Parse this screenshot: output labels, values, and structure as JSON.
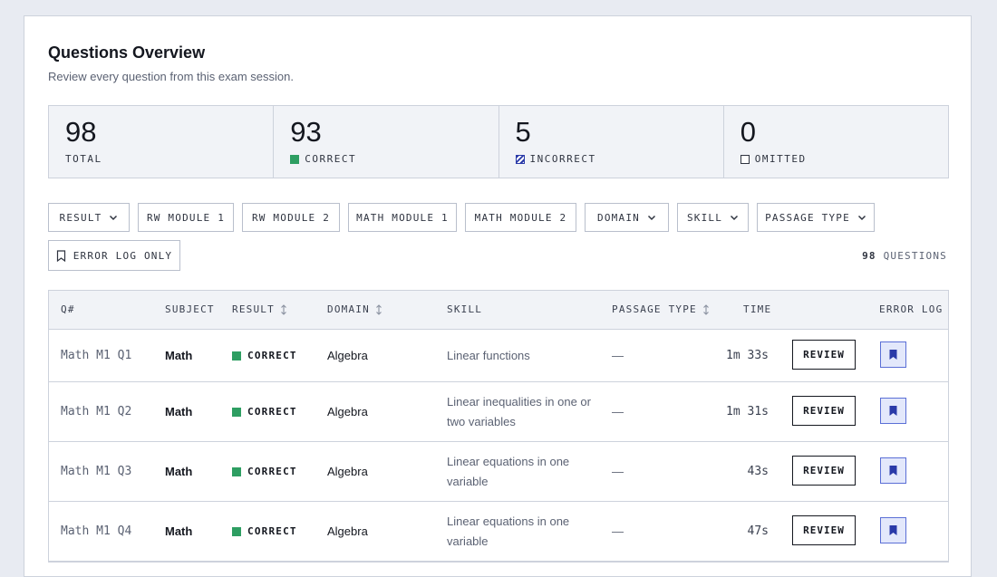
{
  "header": {
    "title": "Questions Overview",
    "subtitle": "Review every question from this exam session."
  },
  "stats": [
    {
      "value": "98",
      "label": "TOTAL",
      "swatch": "none"
    },
    {
      "value": "93",
      "label": "CORRECT",
      "swatch": "correct"
    },
    {
      "value": "5",
      "label": "INCORRECT",
      "swatch": "incorrect"
    },
    {
      "value": "0",
      "label": "OMITTED",
      "swatch": "omitted"
    }
  ],
  "filters": {
    "result": "RESULT",
    "rw_module_1": "RW MODULE 1",
    "rw_module_2": "RW MODULE 2",
    "math_module_1": "MATH MODULE 1",
    "math_module_2": "MATH MODULE 2",
    "domain": "DOMAIN",
    "skill": "SKILL",
    "passage_type": "PASSAGE TYPE",
    "error_log_only": "ERROR LOG ONLY"
  },
  "question_count": {
    "number": "98",
    "label": "QUESTIONS"
  },
  "table": {
    "columns": {
      "q": "Q#",
      "subject": "SUBJECT",
      "result": "RESULT",
      "domain": "DOMAIN",
      "skill": "SKILL",
      "passage_type": "PASSAGE TYPE",
      "time": "TIME",
      "error_log": "ERROR LOG"
    },
    "rows": [
      {
        "q": "Math M1 Q1",
        "subject": "Math",
        "result": "CORRECT",
        "domain": "Algebra",
        "skill": "Linear functions",
        "passage": "—",
        "time": "1m 33s",
        "action": "REVIEW"
      },
      {
        "q": "Math M1 Q2",
        "subject": "Math",
        "result": "CORRECT",
        "domain": "Algebra",
        "skill": "Linear inequalities in one or two variables",
        "passage": "—",
        "time": "1m 31s",
        "action": "REVIEW"
      },
      {
        "q": "Math M1 Q3",
        "subject": "Math",
        "result": "CORRECT",
        "domain": "Algebra",
        "skill": "Linear equations in one variable",
        "passage": "—",
        "time": "43s",
        "action": "REVIEW"
      },
      {
        "q": "Math M1 Q4",
        "subject": "Math",
        "result": "CORRECT",
        "domain": "Algebra",
        "skill": "Linear equations in one variable",
        "passage": "—",
        "time": "47s",
        "action": "REVIEW"
      }
    ]
  },
  "colors": {
    "correct": "#2e9e62",
    "incorrect": "#2a3aa8",
    "bookmark": "#2a3aa8",
    "page_bg": "#e8ebf2"
  },
  "icons": {
    "dropdown": "chevron-down-icon",
    "sort": "sort-icon",
    "bookmark": "bookmark-icon"
  }
}
